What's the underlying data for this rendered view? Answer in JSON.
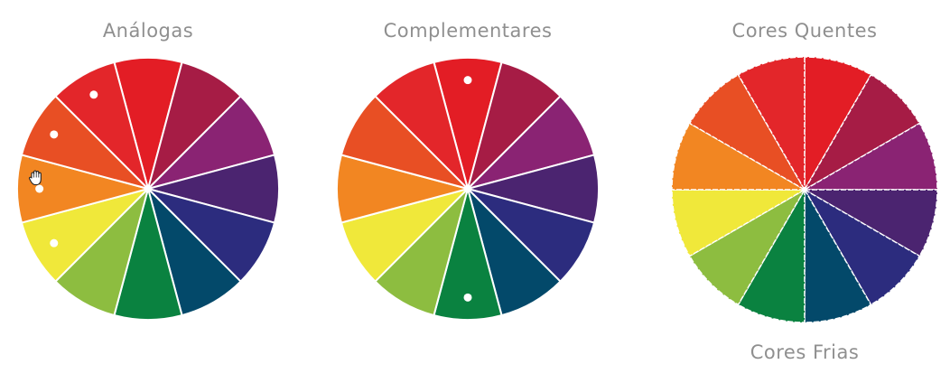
{
  "wheels": [
    {
      "title": "Análogas",
      "marked_segments": [
        11,
        10,
        9,
        8
      ]
    },
    {
      "title": "Complementares",
      "marked_segments": [
        0,
        6
      ]
    },
    {
      "title": "Cores Quentes",
      "bottom_label": "Cores Frias",
      "marked_segments": []
    }
  ],
  "colors": {
    "segments": [
      "#e31d25",
      "#a61c45",
      "#8a2373",
      "#4b2470",
      "#2c2c7e",
      "#03496a",
      "#0a8240",
      "#8dbd40",
      "#f0e83a",
      "#f28622",
      "#e84f24",
      "#e3262a"
    ],
    "divider": "#ffffff",
    "title_text": "#8f8f8f",
    "marker": "#ffffff"
  },
  "icons": {
    "cursor": "hand-grab-icon"
  }
}
